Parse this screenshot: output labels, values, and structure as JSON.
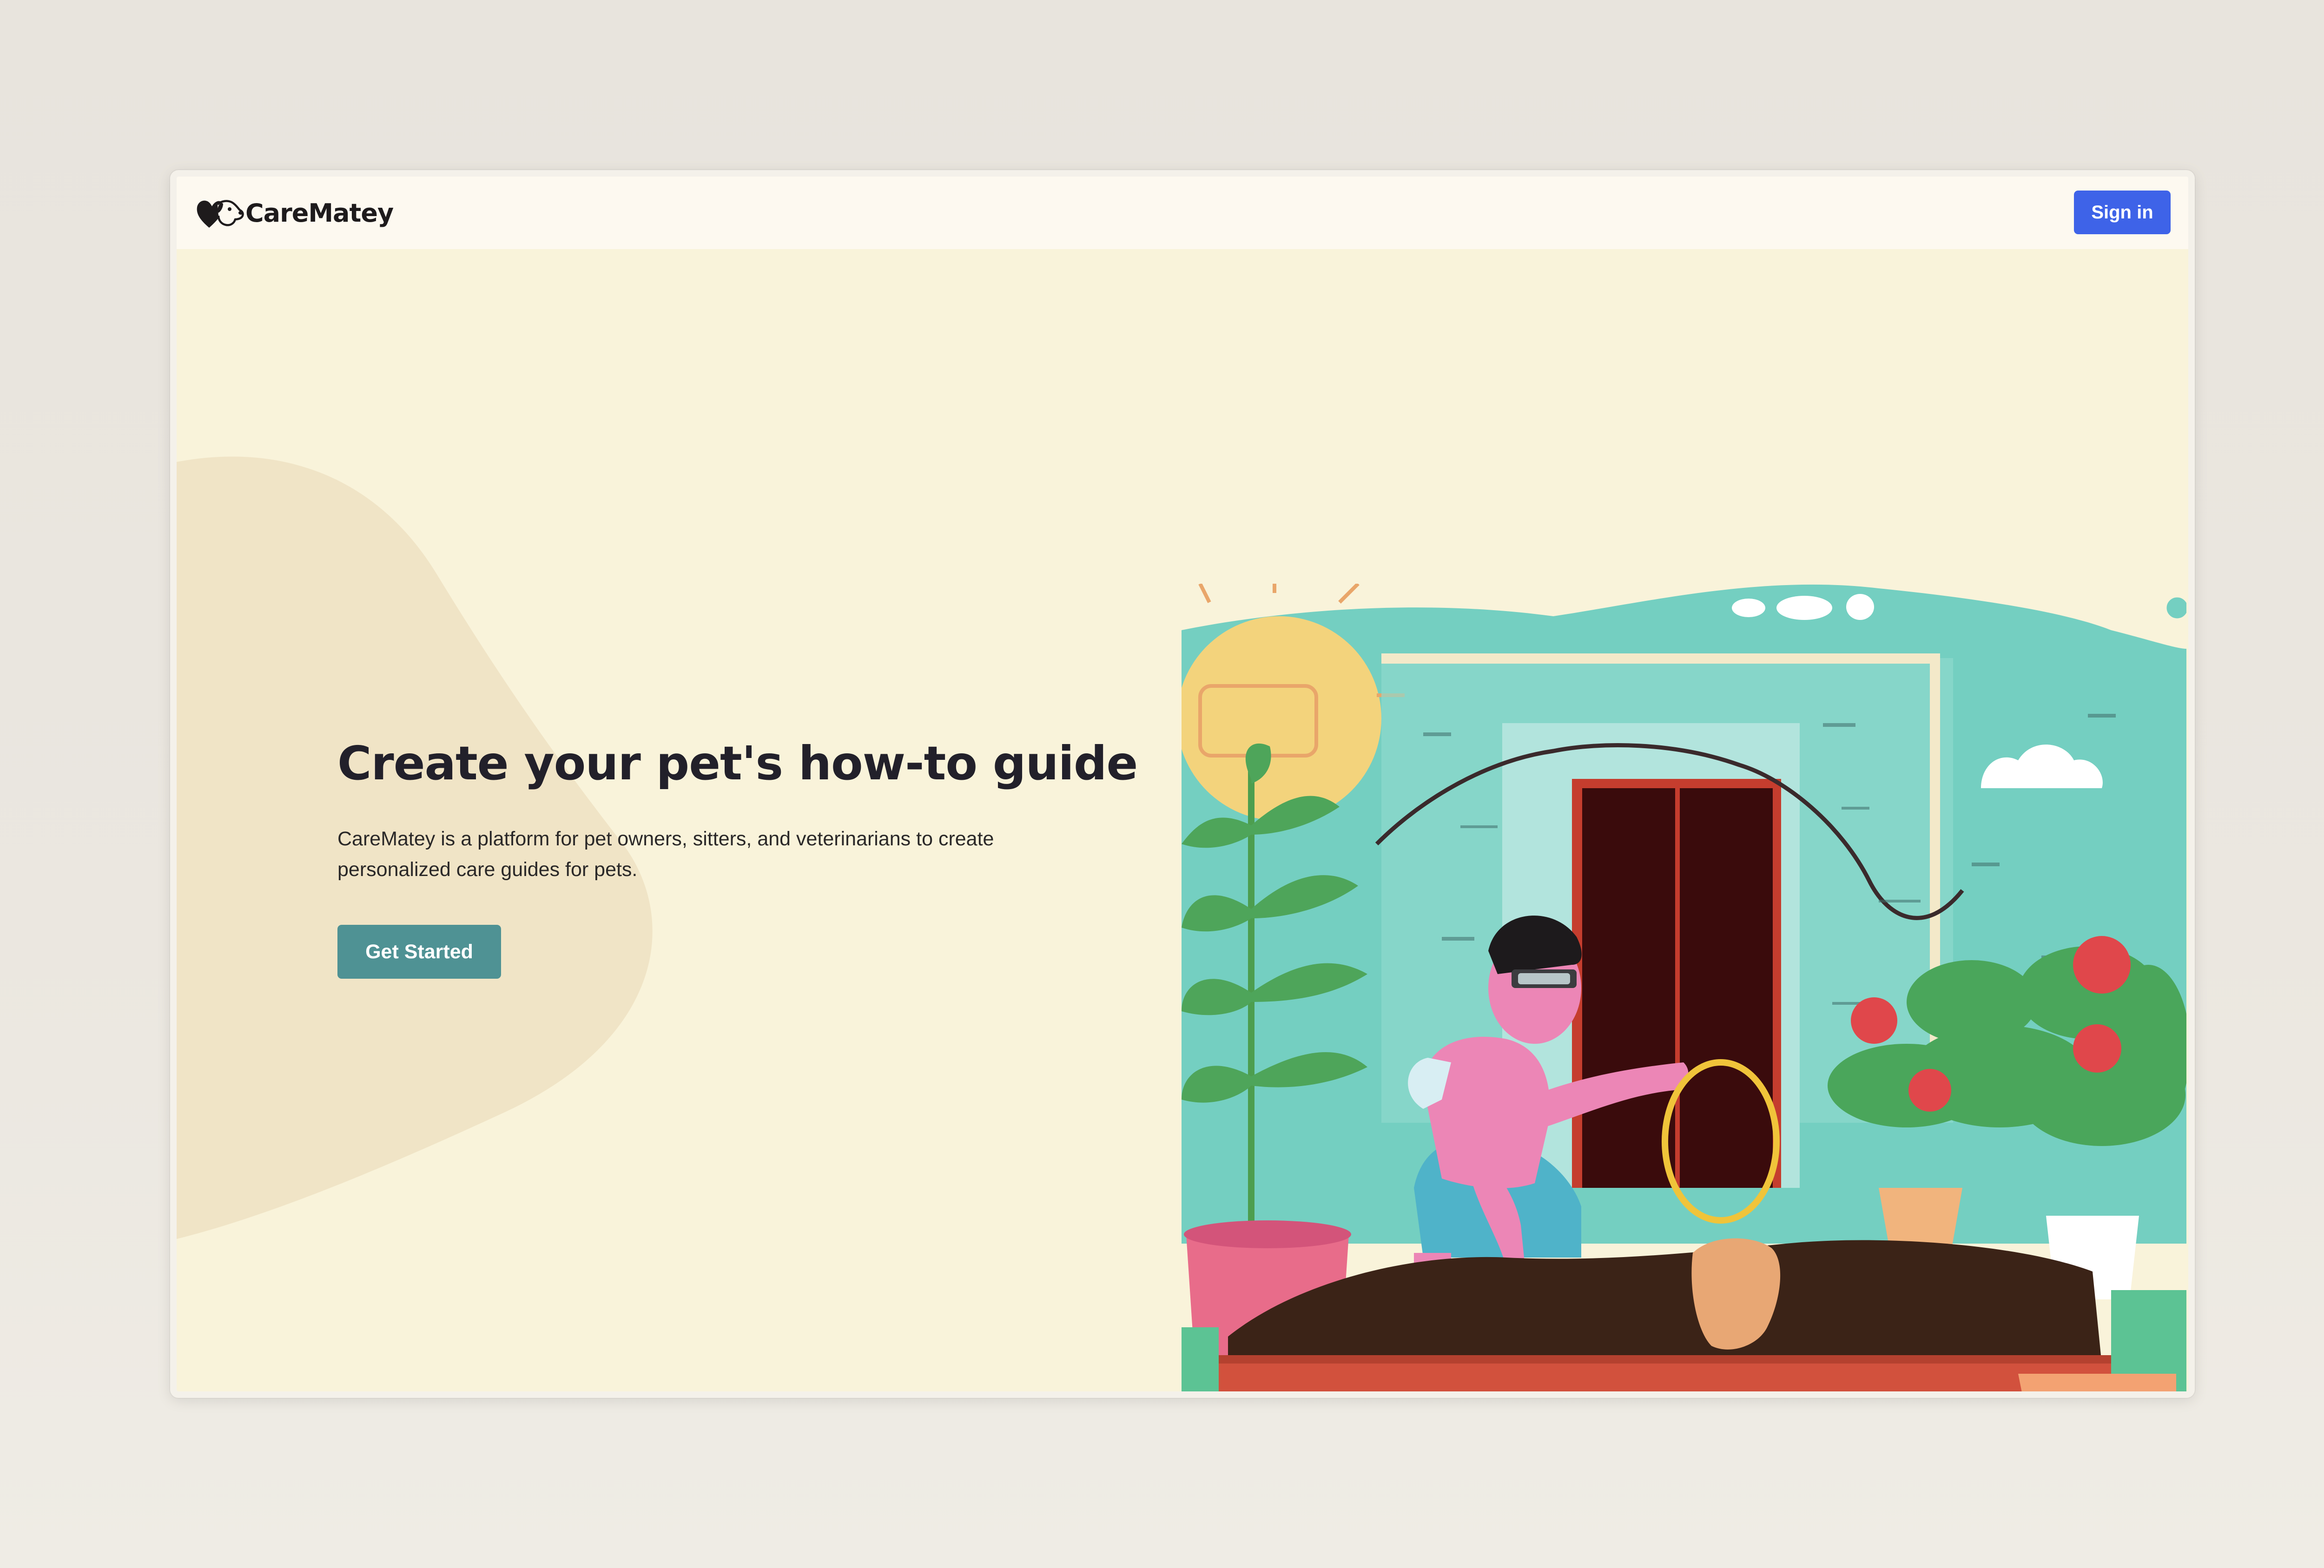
{
  "navbar": {
    "brand_name": "CareMatey",
    "signin_label": "Sign in"
  },
  "hero": {
    "title": "Create your pet's how-to guide",
    "description": "CareMatey is a platform for pet owners, sitters, and veterinarians to create personalized care guides for pets.",
    "cta_label": "Get Started"
  },
  "icons": {
    "logo": "heart-paw-logo-icon"
  },
  "colors": {
    "page_background": "#e9e5de",
    "navbar_background": "#fdf9f0",
    "hero_background": "#f9f3da",
    "blob": "#f0e4c6",
    "signin_button": "#3e63e8",
    "cta_button": "#4f9294",
    "title_text": "#22202a"
  }
}
